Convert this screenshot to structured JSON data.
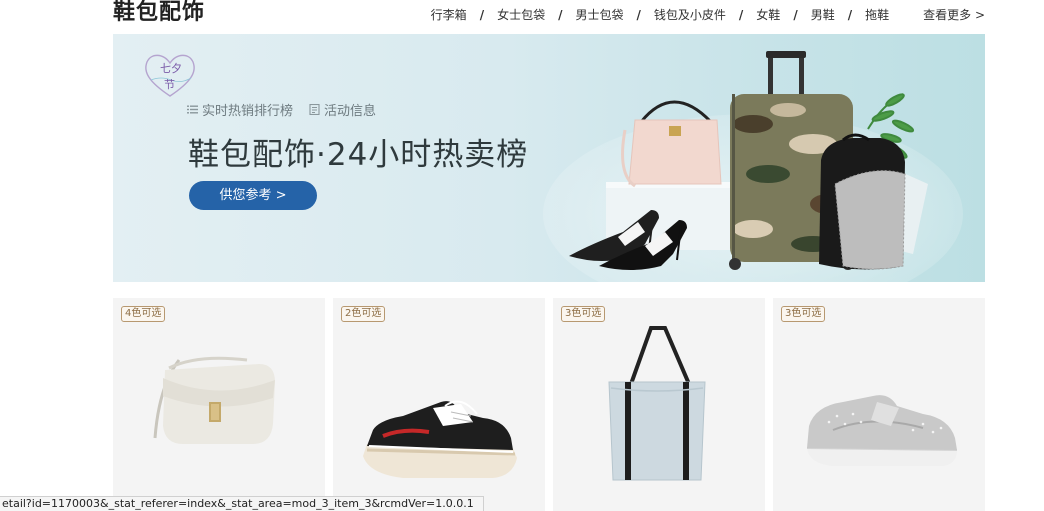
{
  "section": {
    "title": "鞋包配饰",
    "nav": [
      "行李箱",
      "女士包袋",
      "男士包袋",
      "钱包及小皮件",
      "女鞋",
      "男鞋",
      "拖鞋"
    ],
    "separator": "/",
    "more": "查看更多 >"
  },
  "banner": {
    "logo_text": "七夕节",
    "link_rank": "实时热销排行榜",
    "link_activity": "活动信息",
    "title": "鞋包配饰·24小时热卖榜",
    "cta": "供您参考 >"
  },
  "products": [
    {
      "tag": "4色可选",
      "image": "white-crossbody-bag"
    },
    {
      "tag": "2色可选",
      "image": "black-chunky-sneaker"
    },
    {
      "tag": "3色可选",
      "image": "light-blue-tote-bag"
    },
    {
      "tag": "3色可选",
      "image": "grey-running-shoe"
    }
  ],
  "status_url": "etail?id=1170003&_stat_referer=index&_stat_area=mod_3_item_3&rcmdVer=1.0.0.1"
}
